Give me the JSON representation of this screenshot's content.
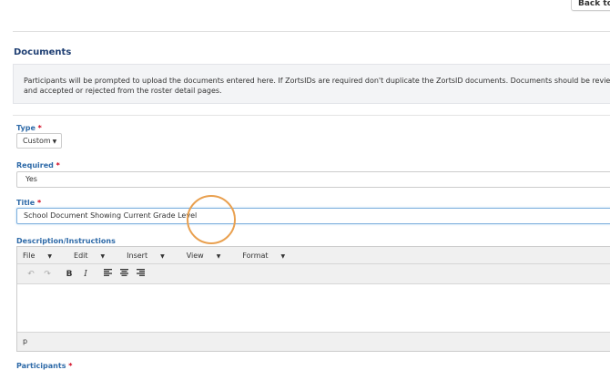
{
  "header": {
    "back_label": "Back to"
  },
  "section": {
    "title": "Documents",
    "info_text": "Participants will be prompted to upload the documents entered here. If ZortsIDs are required don't duplicate the ZortsID documents. Documents should be reviewed and accepted or rejected from the roster detail pages."
  },
  "form": {
    "type": {
      "label": "Type",
      "required_mark": "*",
      "value": "Custom"
    },
    "required": {
      "label": "Required",
      "required_mark": "*",
      "value": "Yes"
    },
    "title": {
      "label": "Title",
      "required_mark": "*",
      "value": "School Document Showing Current Grade Level"
    },
    "description": {
      "label": "Description/Instructions",
      "menus": [
        "File",
        "Edit",
        "Insert",
        "View",
        "Format"
      ],
      "status_path": "p"
    },
    "participants": {
      "label": "Participants",
      "required_mark": "*"
    }
  },
  "icons": {
    "undo": "undo-icon",
    "redo": "redo-icon",
    "bold": "bold-icon",
    "italic": "italic-icon",
    "align_left": "align-left-icon",
    "align_center": "align-center-icon",
    "align_right": "align-right-icon"
  },
  "colors": {
    "accent": "#2e6aa8",
    "title": "#1f3f73",
    "required": "#d0021b",
    "highlight_circle": "#e9a04f"
  }
}
